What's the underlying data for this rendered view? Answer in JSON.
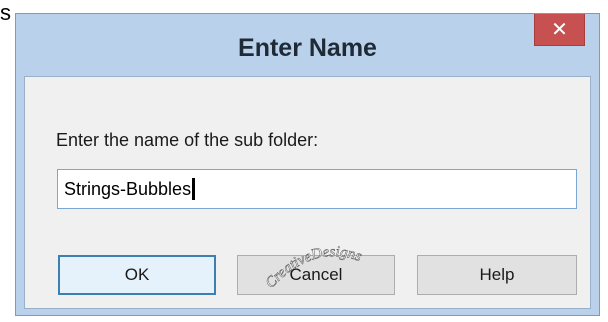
{
  "stray_text": "s",
  "dialog": {
    "title": "Enter Name",
    "close_icon": "close-icon",
    "prompt": "Enter the name of the sub folder:",
    "field_value": "Strings-Bubbles",
    "buttons": {
      "ok": "OK",
      "cancel": "Cancel",
      "help": "Help"
    }
  },
  "watermark": {
    "text": "CreativeDesigns"
  },
  "colors": {
    "frame": "#b9d1ea",
    "close_button": "#c75050",
    "client": "#f0f0f0",
    "default_button_border": "#3c7fb1"
  }
}
